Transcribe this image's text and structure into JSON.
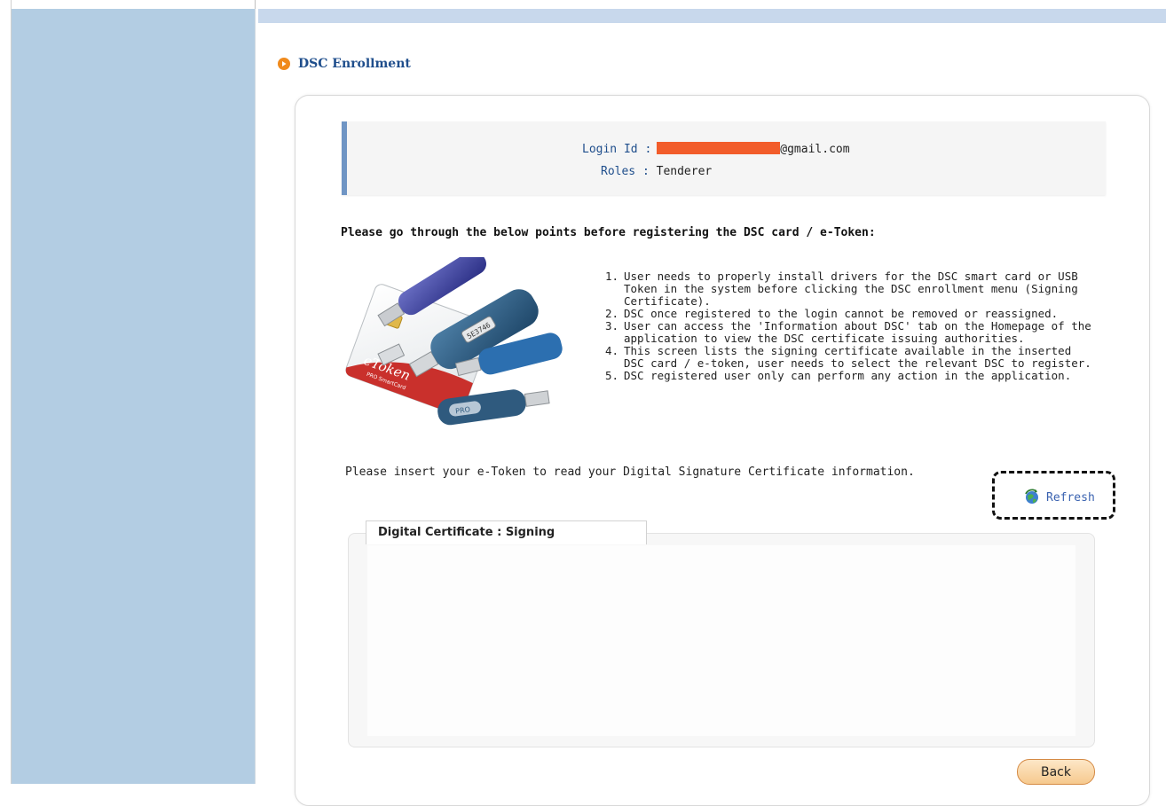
{
  "page": {
    "title": "DSC Enrollment"
  },
  "login": {
    "id_label": "Login Id :",
    "id_value_suffix": "@gmail.com",
    "roles_label": "Roles :",
    "roles_value": "Tenderer"
  },
  "instructions": {
    "heading": "Please go through the below points before registering the DSC card / e-Token:",
    "points": [
      {
        "num": "1.",
        "text": "User needs to properly install drivers for the DSC smart card or USB Token in the system before clicking the DSC enrollment menu (Signing Certificate)."
      },
      {
        "num": "2.",
        "text": "DSC once registered to the login cannot be removed or reassigned."
      },
      {
        "num": "3.",
        "text": "User can access the 'Information about DSC' tab on the Homepage of the application to view the DSC certificate issuing authorities."
      },
      {
        "num": "4.",
        "text": "This screen lists the signing certificate available in the inserted DSC card / e-token, user needs to select the relevant DSC to register."
      },
      {
        "num": "5.",
        "text": "DSC registered user only can perform any action in the application."
      }
    ]
  },
  "insert_note": "Please insert your e-Token to read your Digital Signature Certificate information.",
  "refresh_label": "Refresh",
  "certificate": {
    "tab_label": "Digital Certificate : Signing"
  },
  "back_label": "Back",
  "image_text": {
    "card_brand": "eToken",
    "card_sub": "PRO SmartCard",
    "token_serial": "5E3746",
    "token_pro": "PRO"
  },
  "colors": {
    "sidebar": "#b3cde3",
    "title": "#1f4e8c",
    "accent_orange": "#f08a1c",
    "redaction": "#f25c2a",
    "link": "#3a62b0"
  },
  "icons": {
    "title": "orange-play-circle-icon",
    "refresh": "refresh-globe-icon"
  }
}
